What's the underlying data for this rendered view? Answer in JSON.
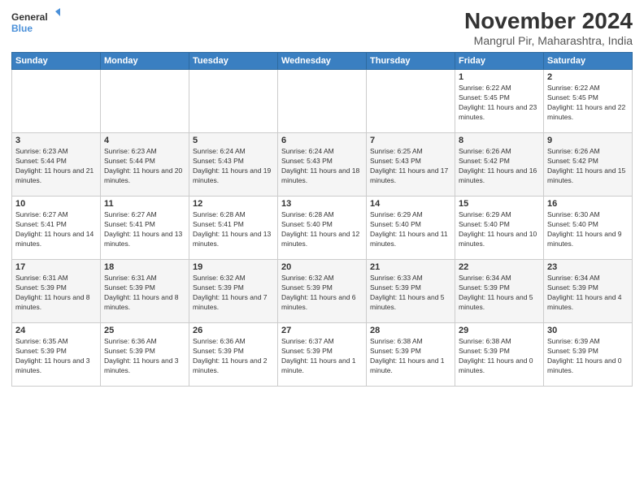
{
  "logo": {
    "line1": "General",
    "line2": "Blue"
  },
  "title": "November 2024",
  "subtitle": "Mangrul Pir, Maharashtra, India",
  "weekdays": [
    "Sunday",
    "Monday",
    "Tuesday",
    "Wednesday",
    "Thursday",
    "Friday",
    "Saturday"
  ],
  "weeks": [
    [
      {
        "day": "",
        "info": ""
      },
      {
        "day": "",
        "info": ""
      },
      {
        "day": "",
        "info": ""
      },
      {
        "day": "",
        "info": ""
      },
      {
        "day": "",
        "info": ""
      },
      {
        "day": "1",
        "info": "Sunrise: 6:22 AM\nSunset: 5:45 PM\nDaylight: 11 hours and 23 minutes."
      },
      {
        "day": "2",
        "info": "Sunrise: 6:22 AM\nSunset: 5:45 PM\nDaylight: 11 hours and 22 minutes."
      }
    ],
    [
      {
        "day": "3",
        "info": "Sunrise: 6:23 AM\nSunset: 5:44 PM\nDaylight: 11 hours and 21 minutes."
      },
      {
        "day": "4",
        "info": "Sunrise: 6:23 AM\nSunset: 5:44 PM\nDaylight: 11 hours and 20 minutes."
      },
      {
        "day": "5",
        "info": "Sunrise: 6:24 AM\nSunset: 5:43 PM\nDaylight: 11 hours and 19 minutes."
      },
      {
        "day": "6",
        "info": "Sunrise: 6:24 AM\nSunset: 5:43 PM\nDaylight: 11 hours and 18 minutes."
      },
      {
        "day": "7",
        "info": "Sunrise: 6:25 AM\nSunset: 5:43 PM\nDaylight: 11 hours and 17 minutes."
      },
      {
        "day": "8",
        "info": "Sunrise: 6:26 AM\nSunset: 5:42 PM\nDaylight: 11 hours and 16 minutes."
      },
      {
        "day": "9",
        "info": "Sunrise: 6:26 AM\nSunset: 5:42 PM\nDaylight: 11 hours and 15 minutes."
      }
    ],
    [
      {
        "day": "10",
        "info": "Sunrise: 6:27 AM\nSunset: 5:41 PM\nDaylight: 11 hours and 14 minutes."
      },
      {
        "day": "11",
        "info": "Sunrise: 6:27 AM\nSunset: 5:41 PM\nDaylight: 11 hours and 13 minutes."
      },
      {
        "day": "12",
        "info": "Sunrise: 6:28 AM\nSunset: 5:41 PM\nDaylight: 11 hours and 13 minutes."
      },
      {
        "day": "13",
        "info": "Sunrise: 6:28 AM\nSunset: 5:40 PM\nDaylight: 11 hours and 12 minutes."
      },
      {
        "day": "14",
        "info": "Sunrise: 6:29 AM\nSunset: 5:40 PM\nDaylight: 11 hours and 11 minutes."
      },
      {
        "day": "15",
        "info": "Sunrise: 6:29 AM\nSunset: 5:40 PM\nDaylight: 11 hours and 10 minutes."
      },
      {
        "day": "16",
        "info": "Sunrise: 6:30 AM\nSunset: 5:40 PM\nDaylight: 11 hours and 9 minutes."
      }
    ],
    [
      {
        "day": "17",
        "info": "Sunrise: 6:31 AM\nSunset: 5:39 PM\nDaylight: 11 hours and 8 minutes."
      },
      {
        "day": "18",
        "info": "Sunrise: 6:31 AM\nSunset: 5:39 PM\nDaylight: 11 hours and 8 minutes."
      },
      {
        "day": "19",
        "info": "Sunrise: 6:32 AM\nSunset: 5:39 PM\nDaylight: 11 hours and 7 minutes."
      },
      {
        "day": "20",
        "info": "Sunrise: 6:32 AM\nSunset: 5:39 PM\nDaylight: 11 hours and 6 minutes."
      },
      {
        "day": "21",
        "info": "Sunrise: 6:33 AM\nSunset: 5:39 PM\nDaylight: 11 hours and 5 minutes."
      },
      {
        "day": "22",
        "info": "Sunrise: 6:34 AM\nSunset: 5:39 PM\nDaylight: 11 hours and 5 minutes."
      },
      {
        "day": "23",
        "info": "Sunrise: 6:34 AM\nSunset: 5:39 PM\nDaylight: 11 hours and 4 minutes."
      }
    ],
    [
      {
        "day": "24",
        "info": "Sunrise: 6:35 AM\nSunset: 5:39 PM\nDaylight: 11 hours and 3 minutes."
      },
      {
        "day": "25",
        "info": "Sunrise: 6:36 AM\nSunset: 5:39 PM\nDaylight: 11 hours and 3 minutes."
      },
      {
        "day": "26",
        "info": "Sunrise: 6:36 AM\nSunset: 5:39 PM\nDaylight: 11 hours and 2 minutes."
      },
      {
        "day": "27",
        "info": "Sunrise: 6:37 AM\nSunset: 5:39 PM\nDaylight: 11 hours and 1 minute."
      },
      {
        "day": "28",
        "info": "Sunrise: 6:38 AM\nSunset: 5:39 PM\nDaylight: 11 hours and 1 minute."
      },
      {
        "day": "29",
        "info": "Sunrise: 6:38 AM\nSunset: 5:39 PM\nDaylight: 11 hours and 0 minutes."
      },
      {
        "day": "30",
        "info": "Sunrise: 6:39 AM\nSunset: 5:39 PM\nDaylight: 11 hours and 0 minutes."
      }
    ]
  ]
}
